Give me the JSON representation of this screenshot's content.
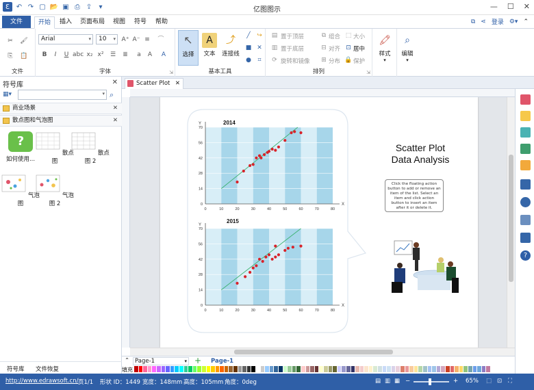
{
  "app": {
    "title": "亿图图示"
  },
  "menu": {
    "file": "文件",
    "tabs": [
      "开始",
      "插入",
      "页面布局",
      "视图",
      "符号",
      "帮助"
    ],
    "active_tab": "开始",
    "login": "登录"
  },
  "ribbon": {
    "font_name": "Arial",
    "font_size": "10",
    "groups": {
      "file": "文件",
      "font": "字体",
      "basic_tools": "基本工具",
      "arrange": "排列"
    },
    "tools": {
      "select": "选择",
      "text": "文本",
      "connector": "连接线"
    },
    "arrange": {
      "bring_front": "置于顶层",
      "send_back": "置于底层",
      "rotate_mirror": "旋转和镜像",
      "group": "组合",
      "align": "对齐",
      "distribute": "分布",
      "size": "大小",
      "center": "居中",
      "protect": "保护"
    },
    "style": "样式",
    "edit": "编辑"
  },
  "left_panel": {
    "title": "符号库",
    "categories": [
      "商业场景",
      "散点图和气泡图"
    ],
    "shapes": [
      "如何使用...",
      "散点图",
      "散点图 2",
      "气泡图",
      "气泡图 2"
    ],
    "footer_tabs": [
      "符号库",
      "文件恢复"
    ]
  },
  "document": {
    "tab": "Scatter Plot"
  },
  "canvas": {
    "title_line1": "Scatter Plot",
    "title_line2": "Data Analysis",
    "note": "Click the floating action button to add or remove an item of the list. Select an item and click action button to insert an item after it or delete it."
  },
  "chart_data": [
    {
      "type": "scatter",
      "title": "2014",
      "xlabel": "X",
      "ylabel": "Y",
      "x_ticks": [
        0,
        10,
        20,
        30,
        40,
        50,
        60,
        70,
        80
      ],
      "y_ticks": [
        0,
        14,
        28,
        42,
        56,
        70
      ],
      "xlim": [
        0,
        80
      ],
      "ylim": [
        0,
        70
      ],
      "points": [
        [
          20,
          20
        ],
        [
          24,
          30
        ],
        [
          28,
          35
        ],
        [
          30,
          36
        ],
        [
          32,
          42
        ],
        [
          34,
          44
        ],
        [
          35,
          42
        ],
        [
          37,
          45
        ],
        [
          39,
          47
        ],
        [
          40,
          48
        ],
        [
          42,
          50
        ],
        [
          44,
          49
        ],
        [
          46,
          52
        ],
        [
          50,
          58
        ],
        [
          54,
          65
        ],
        [
          56,
          66
        ],
        [
          60,
          65
        ]
      ],
      "trendline": [
        [
          10,
          14
        ],
        [
          58,
          70
        ]
      ]
    },
    {
      "type": "scatter",
      "title": "2015",
      "xlabel": "X",
      "ylabel": "Y",
      "x_ticks": [
        0,
        10,
        20,
        30,
        40,
        50,
        60,
        70,
        80
      ],
      "y_ticks": [
        0,
        14,
        28,
        42,
        56,
        70
      ],
      "xlim": [
        0,
        80
      ],
      "ylim": [
        0,
        70
      ],
      "points": [
        [
          20,
          20
        ],
        [
          25,
          26
        ],
        [
          28,
          30
        ],
        [
          30,
          34
        ],
        [
          32,
          36
        ],
        [
          34,
          42
        ],
        [
          36,
          40
        ],
        [
          38,
          44
        ],
        [
          40,
          46
        ],
        [
          42,
          42
        ],
        [
          44,
          44
        ],
        [
          46,
          46
        ],
        [
          50,
          50
        ],
        [
          52,
          52
        ],
        [
          55,
          53
        ],
        [
          60,
          54
        ],
        [
          44,
          54
        ]
      ],
      "trendline": [
        [
          10,
          14
        ],
        [
          60,
          70
        ]
      ]
    }
  ],
  "pagebar": {
    "page_select": "Page-1",
    "page_tab": "Page-1",
    "fill_label": "填充"
  },
  "status": {
    "url": "http://www.edrawsoft.cn/",
    "page": "页1/1",
    "shape_id": "形状 ID：1449",
    "width": "宽度：148mm",
    "height": "高度：105mm",
    "angle": "角度：0deg",
    "zoom": "65%"
  },
  "palette_colors": [
    "#c00000",
    "#ff0000",
    "#ff6699",
    "#ff99cc",
    "#ff66ff",
    "#cc66ff",
    "#9966ff",
    "#6666ff",
    "#3399ff",
    "#00ccff",
    "#00ffff",
    "#33cc99",
    "#00cc66",
    "#66ff66",
    "#99ff33",
    "#ccff33",
    "#ffff00",
    "#ffcc00",
    "#ff9900",
    "#ff6600",
    "#cc6600",
    "#996633",
    "#663300",
    "#999999",
    "#666666",
    "#333333",
    "#000000",
    "#ffffff",
    "#cccccc",
    "#99ccff",
    "#6699cc",
    "#336699",
    "#003366",
    "#ccffcc",
    "#99cc99",
    "#669966",
    "#336633",
    "#ffcccc",
    "#cc9999",
    "#996666",
    "#663333",
    "#ffffcc",
    "#cccc99",
    "#999966",
    "#666633",
    "#ccccff",
    "#9999cc",
    "#666699",
    "#333366",
    "#e6b8af",
    "#f4cccc",
    "#fce5cd",
    "#fff2cc",
    "#d9ead3",
    "#d0e0e3",
    "#c9daf8",
    "#cfe2f3",
    "#d9d2e9",
    "#ead1dc",
    "#dd7e6b",
    "#ea9999",
    "#f9cb9c",
    "#ffe599",
    "#b6d7a8",
    "#a2c4c9",
    "#a4c2f4",
    "#9fc5e8",
    "#b4a7d6",
    "#d5a6bd",
    "#cc4125",
    "#e06666",
    "#f6b26b",
    "#ffd966",
    "#93c47d",
    "#76a5af",
    "#6d9eeb",
    "#6fa8dc",
    "#8e7cc3",
    "#c27ba0"
  ]
}
